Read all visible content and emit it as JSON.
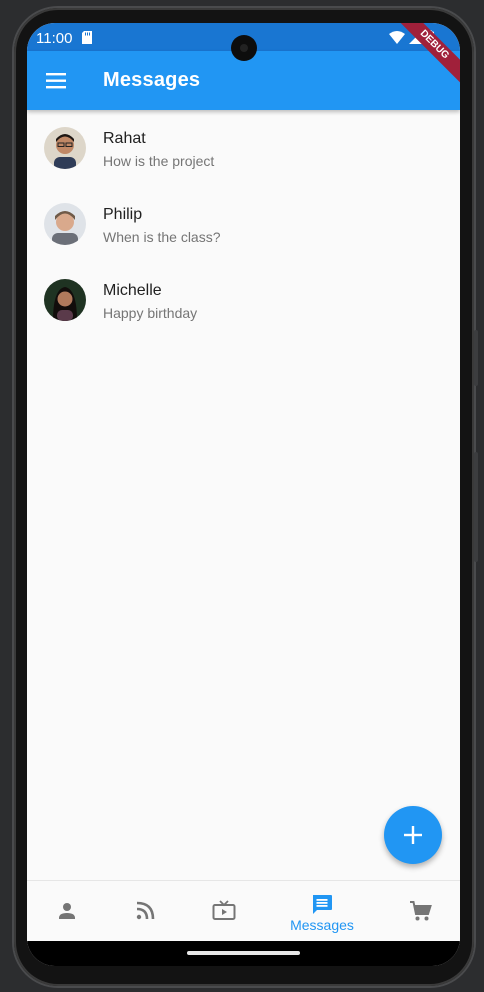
{
  "status_bar": {
    "time": "11:00"
  },
  "app_bar": {
    "title": "Messages",
    "debug_banner": "DEBUG"
  },
  "conversations": [
    {
      "name": "Rahat",
      "message": "How is the project"
    },
    {
      "name": "Philip",
      "message": "When is the class?"
    },
    {
      "name": "Michelle",
      "message": "Happy birthday"
    }
  ],
  "bottom_nav": {
    "items": [
      {
        "icon": "person-icon",
        "label": ""
      },
      {
        "icon": "rss-feed-icon",
        "label": ""
      },
      {
        "icon": "tv-icon",
        "label": ""
      },
      {
        "icon": "message-icon",
        "label": "Messages",
        "active": true
      },
      {
        "icon": "cart-icon",
        "label": ""
      }
    ]
  },
  "colors": {
    "status_bar": "#1976d2",
    "app_bar": "#2196f3",
    "fab": "#2196f3",
    "active_nav": "#2196f3",
    "inactive_nav": "#757575",
    "debug_banner": "#a0203a"
  }
}
